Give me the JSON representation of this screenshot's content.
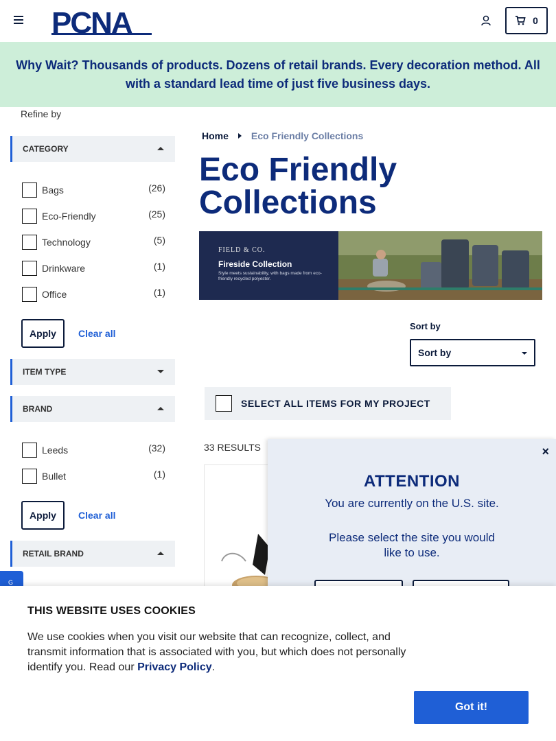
{
  "header": {
    "logo_text": "PCNA",
    "cart_count": "0"
  },
  "promo": {
    "text": "Why Wait? Thousands of products. Dozens of retail brands. Every decoration method. All with a standard lead time of just five business days."
  },
  "sidebar": {
    "refine_label": "Refine by",
    "category": {
      "title": "CATEGORY",
      "items": [
        {
          "label": "Bags",
          "count": "(26)"
        },
        {
          "label": "Eco-Friendly",
          "count": "(25)"
        },
        {
          "label": "Technology",
          "count": "(5)"
        },
        {
          "label": "Drinkware",
          "count": "(1)"
        },
        {
          "label": "Office",
          "count": "(1)"
        }
      ],
      "apply_label": "Apply",
      "clear_label": "Clear all"
    },
    "item_type": {
      "title": "ITEM TYPE"
    },
    "brand": {
      "title": "BRAND",
      "items": [
        {
          "label": "Leeds",
          "count": "(32)"
        },
        {
          "label": "Bullet",
          "count": "(1)"
        }
      ],
      "apply_label": "Apply",
      "clear_label": "Clear all"
    },
    "retail_brand": {
      "title": "RETAIL BRAND"
    },
    "side_tab_text": "G"
  },
  "main": {
    "breadcrumb": {
      "home": "Home",
      "current": "Eco Friendly Collections"
    },
    "title": "Eco Friendly Collections",
    "hero": {
      "brand": "FIELD & CO.",
      "title": "Fireside Collection",
      "subtitle": "Style meets sustainability, with bags made from eco-friendly recycled polyester."
    },
    "sort": {
      "label": "Sort by",
      "selected": "Sort by"
    },
    "select_all_label": "SELECT ALL ITEMS FOR MY PROJECT",
    "results_label": "33 RESULTS"
  },
  "attention": {
    "close": "×",
    "title": "ATTENTION",
    "line1": "You are currently on the U.S. site.",
    "line2": "Please select the site you would like to use."
  },
  "cookie": {
    "title": "THIS WEBSITE USES COOKIES",
    "body": "We use cookies when you visit our website that can recognize, collect, and transmit information that is associated with you, but which does not personally identify you. Read our ",
    "link": "Privacy Policy",
    "period": ".",
    "button": "Got it!"
  },
  "colors": {
    "brand_navy": "#0d2b7a",
    "accent_blue": "#1f5fd6",
    "promo_bg": "#cdeed9"
  }
}
